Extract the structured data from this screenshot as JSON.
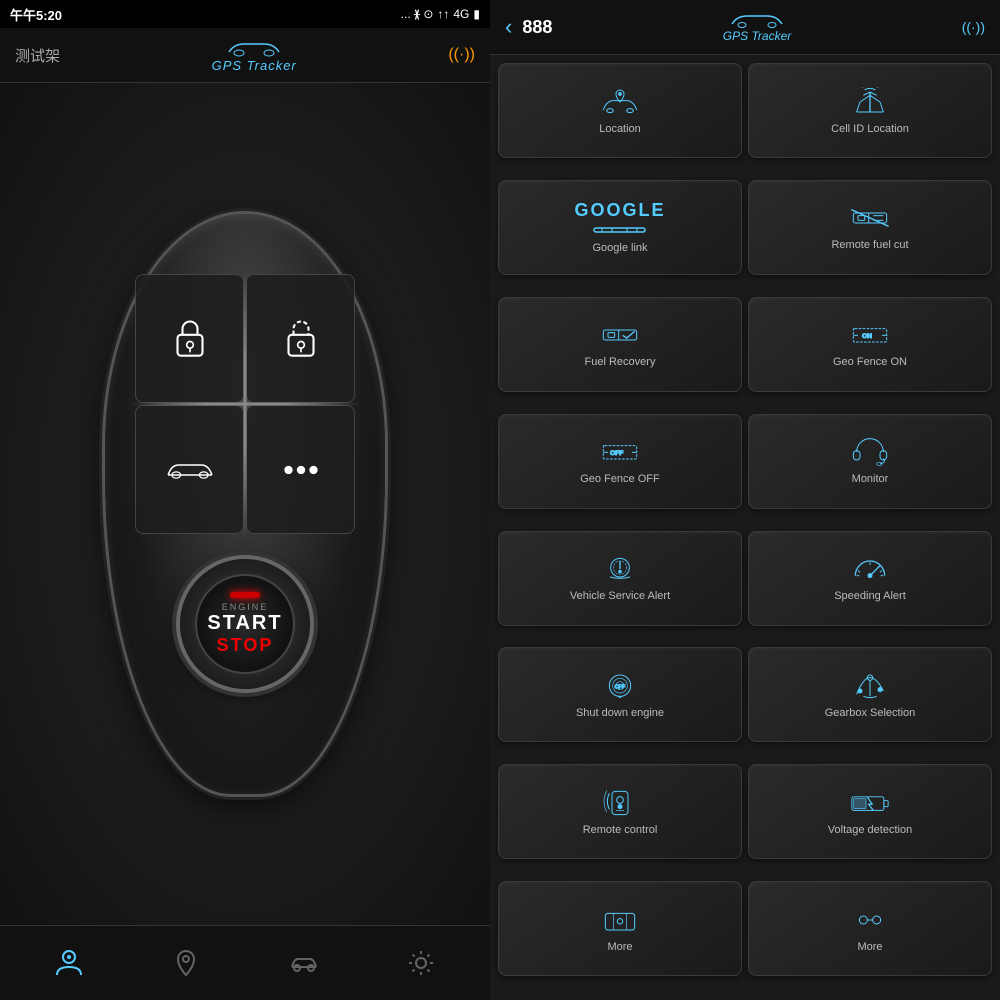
{
  "leftPanel": {
    "statusBar": {
      "time": "午午5:20",
      "rightIcons": "... ᚕ ⊙ ↑ ↑↑ 4G ▮"
    },
    "header": {
      "title": "测试架",
      "gpsText": "GPS Tracker",
      "signalIcon": "((·))"
    },
    "engineButton": {
      "engineLabel": "ENGINE",
      "startLabel": "START",
      "stopLabel": "STOP"
    },
    "bottomTabs": [
      {
        "id": "person",
        "icon": "👤",
        "active": true
      },
      {
        "id": "location",
        "icon": "📍",
        "active": false
      },
      {
        "id": "car",
        "icon": "🚗",
        "active": false
      },
      {
        "id": "settings",
        "icon": "⚙",
        "active": false
      }
    ]
  },
  "rightPanel": {
    "header": {
      "deviceId": "888",
      "gpsText": "GPS Tracker",
      "signalIcon": "((·))"
    },
    "buttons": [
      {
        "id": "location",
        "label": "Location",
        "icon": "location"
      },
      {
        "id": "cell-id-location",
        "label": "Cell ID Location",
        "icon": "tower"
      },
      {
        "id": "google-link",
        "label": "Google link",
        "icon": "google"
      },
      {
        "id": "remote-fuel-cut",
        "label": "Remote fuel cut",
        "icon": "fuel-cut"
      },
      {
        "id": "fuel-recovery",
        "label": "Fuel Recovery",
        "icon": "fuel-check"
      },
      {
        "id": "geo-fence-on",
        "label": "Geo Fence ON",
        "icon": "fence-on"
      },
      {
        "id": "geo-fence-off",
        "label": "Geo Fence OFF",
        "icon": "fence-off"
      },
      {
        "id": "monitor",
        "label": "Monitor",
        "icon": "headset"
      },
      {
        "id": "vehicle-service-alert",
        "label": "Vehicle Service Alert",
        "icon": "service"
      },
      {
        "id": "speeding-alert",
        "label": "Speeding Alert",
        "icon": "speedometer"
      },
      {
        "id": "shut-down-engine",
        "label": "Shut down engine",
        "icon": "shutdown"
      },
      {
        "id": "gearbox-selection",
        "label": "Gearbox  Selection",
        "icon": "gearbox"
      },
      {
        "id": "remote-control",
        "label": "Remote control",
        "icon": "remote"
      },
      {
        "id": "voltage-detection",
        "label": "Voltage detection",
        "icon": "battery"
      },
      {
        "id": "more1",
        "label": "More",
        "icon": "more"
      },
      {
        "id": "more2",
        "label": "More",
        "icon": "more2"
      }
    ]
  }
}
